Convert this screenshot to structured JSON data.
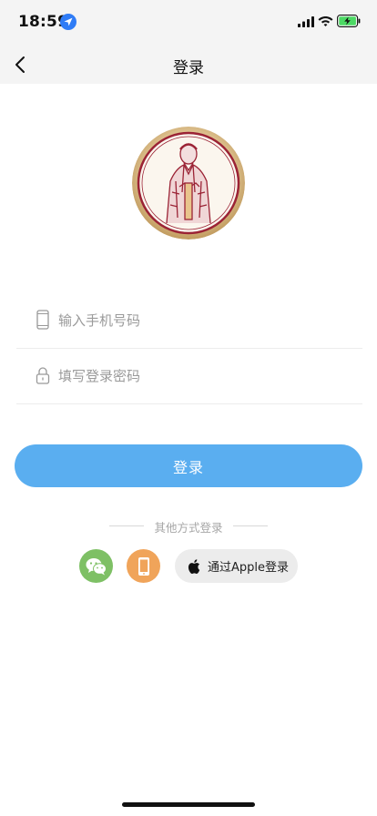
{
  "status_bar": {
    "time": "18:59",
    "icons": [
      "location-arrow-icon",
      "cellular-signal-icon",
      "wifi-icon",
      "battery-charging-icon"
    ]
  },
  "nav": {
    "title": "登录",
    "back_icon": "chevron-left-icon"
  },
  "avatar": {
    "icon": "portrait-illustration"
  },
  "form": {
    "phone": {
      "placeholder": "输入手机号码",
      "value": "",
      "icon": "mobile-phone-icon"
    },
    "password": {
      "placeholder": "填写登录密码",
      "value": "",
      "icon": "lock-icon"
    }
  },
  "login_button": {
    "label": "登录"
  },
  "other_login": {
    "label": "其他方式登录",
    "wechat": {
      "icon": "wechat-icon"
    },
    "phone": {
      "icon": "smartphone-icon"
    },
    "apple": {
      "label": "通过Apple登录",
      "icon": "apple-logo-icon"
    }
  },
  "colors": {
    "primary": "#5aaef0",
    "wechat": "#7ec065",
    "phone": "#f0a45a",
    "bar_bg": "#f4f4f4",
    "battery": "#4cd964",
    "location": "#2f7cf6",
    "avatar_ring": "#c7a46a",
    "avatar_ink": "#9b2335"
  }
}
